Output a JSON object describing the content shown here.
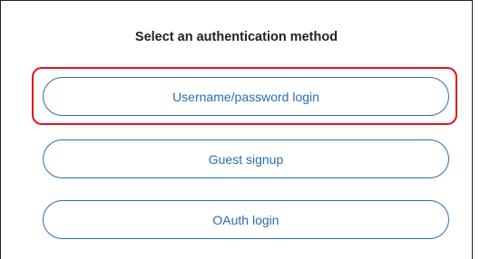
{
  "title": "Select an authentication method",
  "methods": [
    {
      "label": "Username/password login",
      "highlighted": true
    },
    {
      "label": "Guest signup",
      "highlighted": false
    },
    {
      "label": "OAuth login",
      "highlighted": false
    }
  ],
  "colors": {
    "accent": "#2a6fae",
    "highlight": "#e3111b",
    "text": "#222222",
    "background": "#ffffff"
  }
}
